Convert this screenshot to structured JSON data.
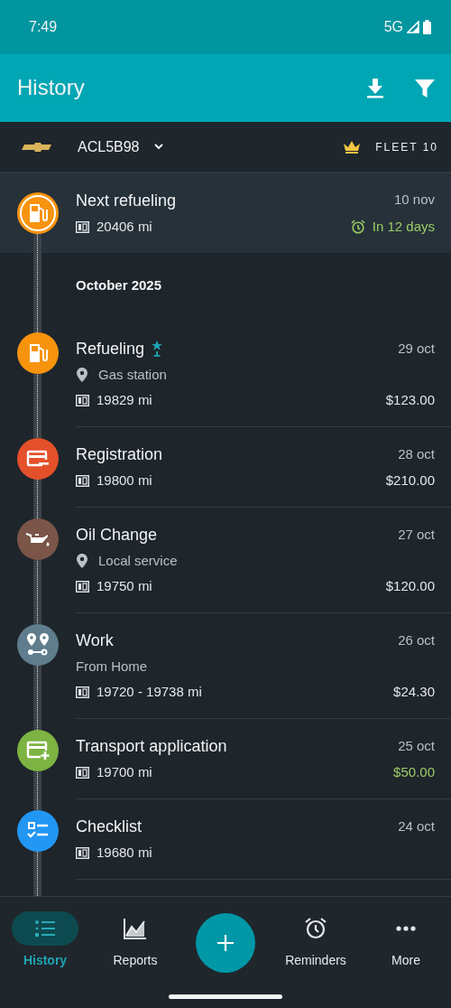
{
  "status_bar": {
    "time": "7:49",
    "network": "5G"
  },
  "app_bar": {
    "title": "History"
  },
  "vehicle": {
    "plate": "ACL5B98",
    "plan": "FLEET 10"
  },
  "next": {
    "kind": "refueling",
    "title": "Next refueling",
    "date": "10 nov",
    "odometer": "20406 mi",
    "due": "In 12 days"
  },
  "section": "October 2025",
  "entries": [
    {
      "kind": "refueling",
      "color": "#f7930d",
      "title": "Refueling",
      "starred": true,
      "place": "Gas station",
      "date": "29 oct",
      "odometer": "19829 mi",
      "amount": "$123.00",
      "income": false
    },
    {
      "kind": "expense",
      "color": "#e4502a",
      "title": "Registration",
      "starred": false,
      "date": "28 oct",
      "odometer": "19800 mi",
      "amount": "$210.00",
      "income": false
    },
    {
      "kind": "service",
      "color": "#7a5548",
      "title": "Oil Change",
      "starred": false,
      "place": "Local service",
      "date": "27 oct",
      "odometer": "19750 mi",
      "amount": "$120.00",
      "income": false
    },
    {
      "kind": "route",
      "color": "#5f7d8c",
      "title": "Work",
      "starred": false,
      "note": "From Home",
      "date": "26 oct",
      "odometer": "19720 - 19738 mi",
      "amount": "$24.30",
      "income": false
    },
    {
      "kind": "income",
      "color": "#7cb342",
      "title": "Transport application",
      "starred": false,
      "date": "25 oct",
      "odometer": "19700 mi",
      "amount": "$50.00",
      "income": true
    },
    {
      "kind": "checklist",
      "color": "#2196f3",
      "title": "Checklist",
      "starred": false,
      "date": "24 oct",
      "odometer": "19680 mi"
    }
  ],
  "nav": [
    {
      "kind": "history",
      "label": "History",
      "selected": true
    },
    {
      "kind": "reports",
      "label": "Reports",
      "selected": false
    },
    {
      "kind": "add"
    },
    {
      "kind": "reminders",
      "label": "Reminders",
      "selected": false
    },
    {
      "kind": "more",
      "label": "More",
      "selected": false
    }
  ]
}
